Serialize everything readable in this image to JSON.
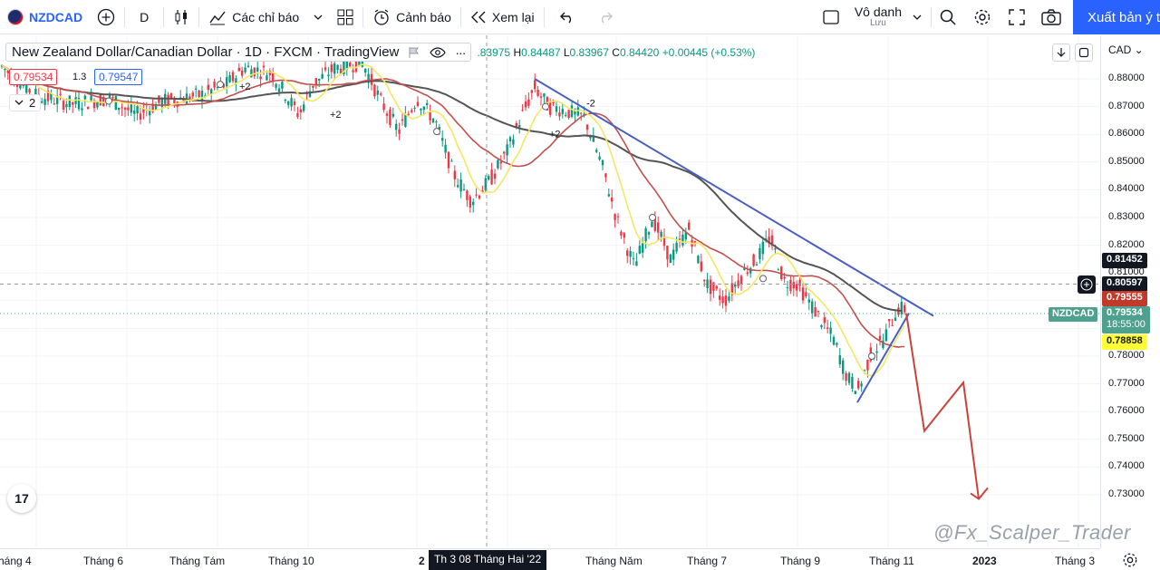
{
  "toolbar": {
    "symbol": "NZDCAD",
    "interval": "D",
    "indicators_label": "Các chỉ báo",
    "alerts_label": "Cảnh báo",
    "replay_label": "Xem lại",
    "save_title": "Vô danh",
    "save_sub": "Lưu",
    "publish_label": "Xuất bản ý t"
  },
  "legend": {
    "title": "New Zealand Dollar/Canadian Dollar · 1D · FXCM · TradingView",
    "open_partial": ".83975",
    "high_key": "H",
    "high": "0.84487",
    "low_key": "L",
    "low": "0.83967",
    "close_key": "C",
    "close": "0.84420",
    "change": "+0.00445 (+0.53%)",
    "bid": "0.79534",
    "spread": "1.3",
    "ask": "0.79547",
    "indicator_count": "2"
  },
  "currency": "CAD",
  "price_axis": [
    "0.88000",
    "0.87000",
    "0.86000",
    "0.85000",
    "0.84000",
    "0.83000",
    "0.82000",
    "0.81000",
    "0.80000",
    "0.79000",
    "0.78000",
    "0.77000",
    "0.76000",
    "0.75000",
    "0.74000",
    "0.73000"
  ],
  "price_tags": {
    "ma200": "0.81452",
    "crosshair": "0.80597",
    "ma100": "0.79555",
    "symbol_tag": "NZDCAD",
    "last_price": "0.79534",
    "countdown": "18:55:00",
    "ma20": "0.78858"
  },
  "time_axis": [
    {
      "label": "háng 4",
      "bold": false
    },
    {
      "label": "Tháng 6",
      "bold": false
    },
    {
      "label": "Tháng Tám",
      "bold": false
    },
    {
      "label": "Tháng 10",
      "bold": false
    },
    {
      "label": "2",
      "bold": true
    },
    {
      "label": "Tháng Năm",
      "bold": false
    },
    {
      "label": "Tháng 7",
      "bold": false
    },
    {
      "label": "Tháng 9",
      "bold": false
    },
    {
      "label": "Tháng 11",
      "bold": false
    },
    {
      "label": "2023",
      "bold": true
    },
    {
      "label": "Tháng 3",
      "bold": false
    }
  ],
  "crosshair_date": "Th 3 08 Tháng Hai '22",
  "chart_marks": [
    "+2",
    "+2",
    "+2",
    "-2"
  ],
  "watermark": "@Fx_Scalper_Trader",
  "logo_text": "17",
  "colors": {
    "ma20": "#f5e663",
    "ma50": "#c0504d",
    "ma200": "#555555",
    "trendline": "#4a5fc1",
    "forecast": "#c9433a",
    "accent": "#2962ff",
    "up": "#089981",
    "down": "#f23645"
  }
}
